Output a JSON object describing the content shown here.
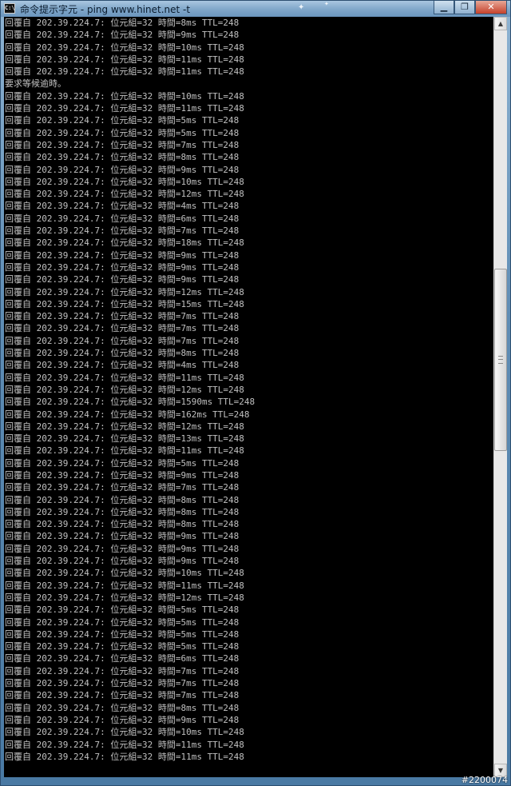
{
  "window": {
    "title": "命令提示字元 - ping  www.hinet.net -t",
    "icon_label": "C:\\",
    "minimize_icon": "minimize-icon",
    "maximize_icon": "maximize-icon",
    "close_icon": "close-icon"
  },
  "console": {
    "lines": [
      "回覆自 202.39.224.7: 位元組=32 時間=8ms TTL=248",
      "回覆自 202.39.224.7: 位元組=32 時間=9ms TTL=248",
      "回覆自 202.39.224.7: 位元組=32 時間=10ms TTL=248",
      "回覆自 202.39.224.7: 位元組=32 時間=11ms TTL=248",
      "回覆自 202.39.224.7: 位元組=32 時間=11ms TTL=248",
      "要求等候逾時。",
      "回覆自 202.39.224.7: 位元組=32 時間=10ms TTL=248",
      "回覆自 202.39.224.7: 位元組=32 時間=11ms TTL=248",
      "回覆自 202.39.224.7: 位元組=32 時間=5ms TTL=248",
      "回覆自 202.39.224.7: 位元組=32 時間=5ms TTL=248",
      "回覆自 202.39.224.7: 位元組=32 時間=7ms TTL=248",
      "回覆自 202.39.224.7: 位元組=32 時間=8ms TTL=248",
      "回覆自 202.39.224.7: 位元組=32 時間=9ms TTL=248",
      "回覆自 202.39.224.7: 位元組=32 時間=10ms TTL=248",
      "回覆自 202.39.224.7: 位元組=32 時間=12ms TTL=248",
      "回覆自 202.39.224.7: 位元組=32 時間=4ms TTL=248",
      "回覆自 202.39.224.7: 位元組=32 時間=6ms TTL=248",
      "回覆自 202.39.224.7: 位元組=32 時間=7ms TTL=248",
      "回覆自 202.39.224.7: 位元組=32 時間=18ms TTL=248",
      "回覆自 202.39.224.7: 位元組=32 時間=9ms TTL=248",
      "回覆自 202.39.224.7: 位元組=32 時間=9ms TTL=248",
      "回覆自 202.39.224.7: 位元組=32 時間=9ms TTL=248",
      "回覆自 202.39.224.7: 位元組=32 時間=12ms TTL=248",
      "回覆自 202.39.224.7: 位元組=32 時間=15ms TTL=248",
      "回覆自 202.39.224.7: 位元組=32 時間=7ms TTL=248",
      "回覆自 202.39.224.7: 位元組=32 時間=7ms TTL=248",
      "回覆自 202.39.224.7: 位元組=32 時間=7ms TTL=248",
      "回覆自 202.39.224.7: 位元組=32 時間=8ms TTL=248",
      "回覆自 202.39.224.7: 位元組=32 時間=4ms TTL=248",
      "回覆自 202.39.224.7: 位元組=32 時間=11ms TTL=248",
      "回覆自 202.39.224.7: 位元組=32 時間=12ms TTL=248",
      "回覆自 202.39.224.7: 位元組=32 時間=1590ms TTL=248",
      "回覆自 202.39.224.7: 位元組=32 時間=162ms TTL=248",
      "回覆自 202.39.224.7: 位元組=32 時間=12ms TTL=248",
      "回覆自 202.39.224.7: 位元組=32 時間=13ms TTL=248",
      "回覆自 202.39.224.7: 位元組=32 時間=11ms TTL=248",
      "回覆自 202.39.224.7: 位元組=32 時間=5ms TTL=248",
      "回覆自 202.39.224.7: 位元組=32 時間=9ms TTL=248",
      "回覆自 202.39.224.7: 位元組=32 時間=7ms TTL=248",
      "回覆自 202.39.224.7: 位元組=32 時間=8ms TTL=248",
      "回覆自 202.39.224.7: 位元組=32 時間=8ms TTL=248",
      "回覆自 202.39.224.7: 位元組=32 時間=8ms TTL=248",
      "回覆自 202.39.224.7: 位元組=32 時間=9ms TTL=248",
      "回覆自 202.39.224.7: 位元組=32 時間=9ms TTL=248",
      "回覆自 202.39.224.7: 位元組=32 時間=9ms TTL=248",
      "回覆自 202.39.224.7: 位元組=32 時間=10ms TTL=248",
      "回覆自 202.39.224.7: 位元組=32 時間=11ms TTL=248",
      "回覆自 202.39.224.7: 位元組=32 時間=12ms TTL=248",
      "回覆自 202.39.224.7: 位元組=32 時間=5ms TTL=248",
      "回覆自 202.39.224.7: 位元組=32 時間=5ms TTL=248",
      "回覆自 202.39.224.7: 位元組=32 時間=5ms TTL=248",
      "回覆自 202.39.224.7: 位元組=32 時間=5ms TTL=248",
      "回覆自 202.39.224.7: 位元組=32 時間=6ms TTL=248",
      "回覆自 202.39.224.7: 位元組=32 時間=7ms TTL=248",
      "回覆自 202.39.224.7: 位元組=32 時間=7ms TTL=248",
      "回覆自 202.39.224.7: 位元組=32 時間=7ms TTL=248",
      "回覆自 202.39.224.7: 位元組=32 時間=8ms TTL=248",
      "回覆自 202.39.224.7: 位元組=32 時間=9ms TTL=248",
      "回覆自 202.39.224.7: 位元組=32 時間=10ms TTL=248",
      "回覆自 202.39.224.7: 位元組=32 時間=11ms TTL=248",
      "回覆自 202.39.224.7: 位元組=32 時間=11ms TTL=248"
    ]
  },
  "watermark": "#2200074",
  "colors": {
    "console_bg": "#000000",
    "console_text": "#c0c0c0",
    "titlebar": "#7fa6c9",
    "close_button": "#c5412b"
  }
}
